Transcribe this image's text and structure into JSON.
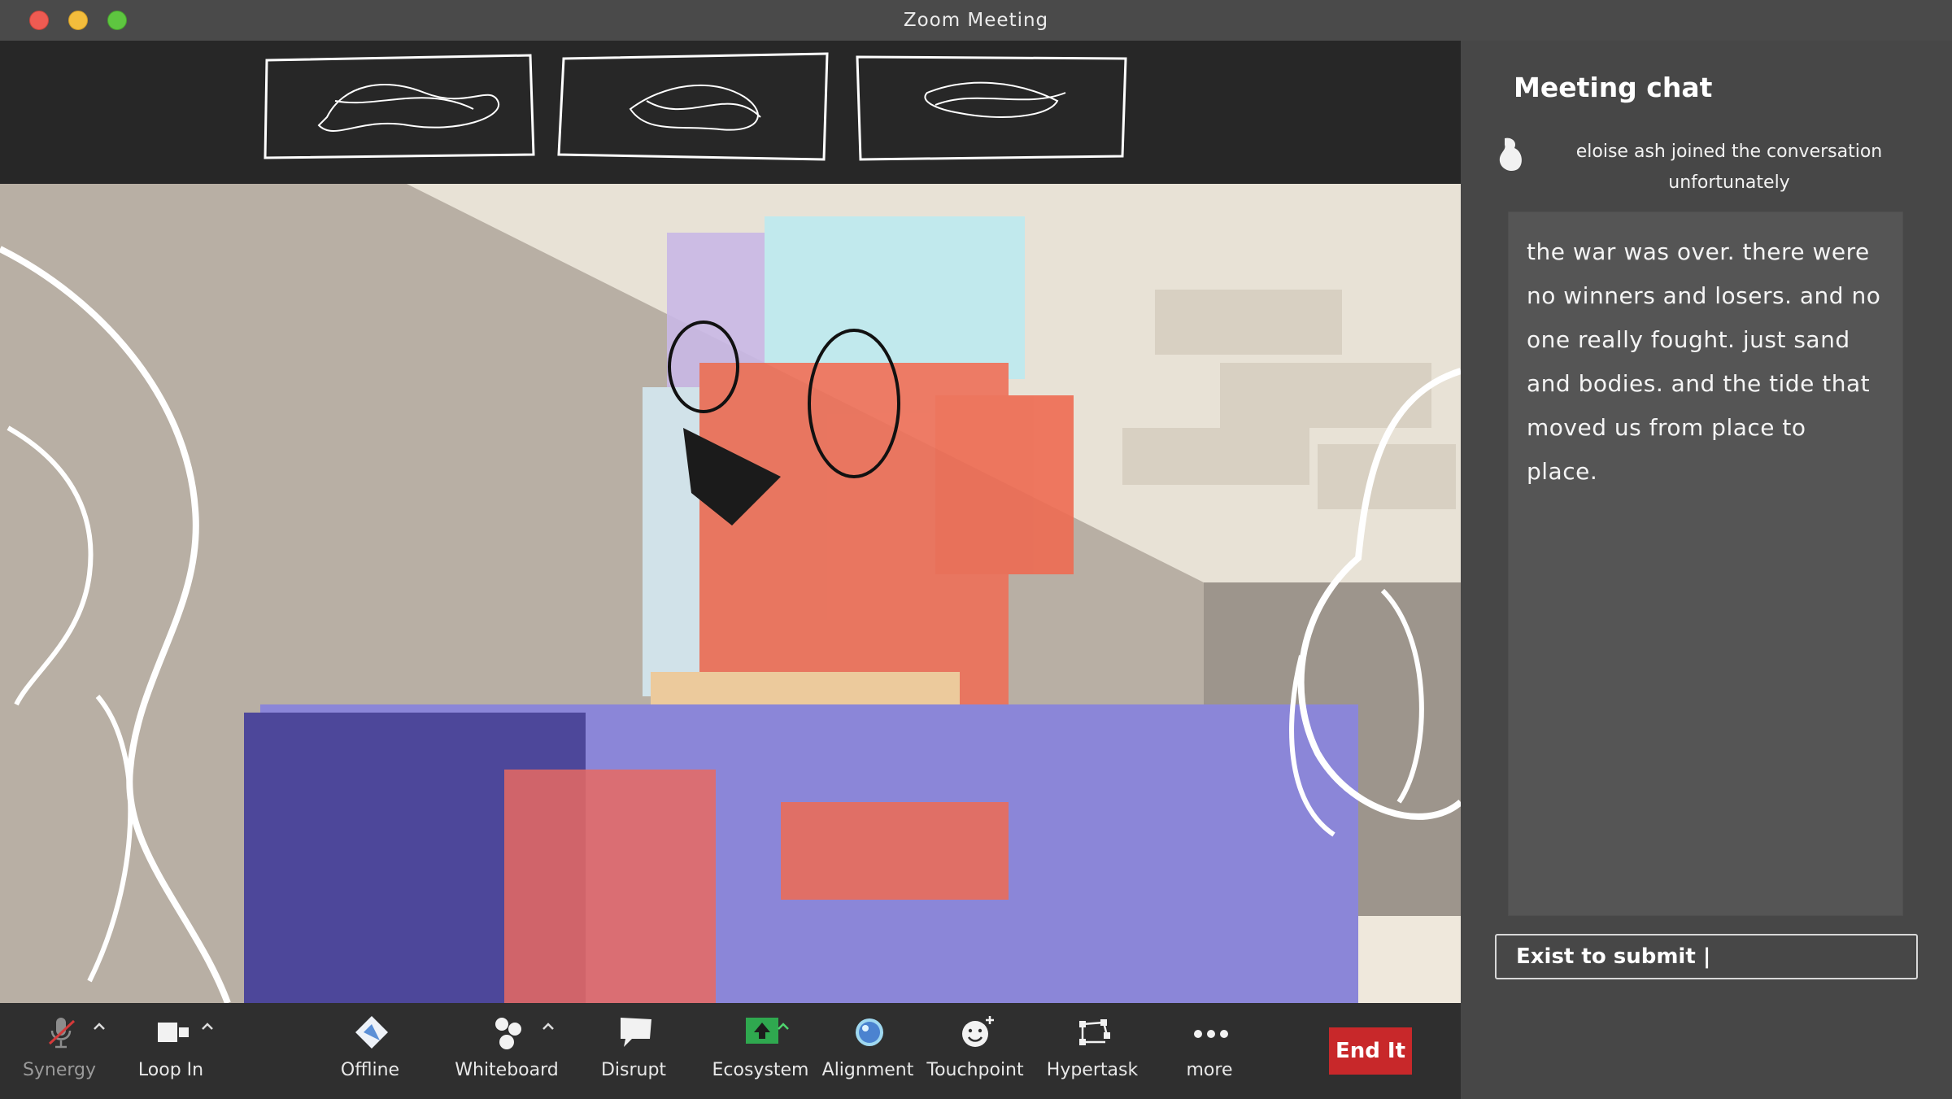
{
  "window": {
    "title": "Zoom Meeting"
  },
  "chat": {
    "title": "Meeting chat",
    "join_notice": "eloise ash  joined the conversation unfortunately",
    "message": "the war was over. there were no winners and losers. and no one really fought. just sand and bodies. and the tide that moved us from place to place.",
    "input_value": "Exist to submit |"
  },
  "toolbar": {
    "items": [
      {
        "label": "Synergy",
        "icon": "muted-mic-icon"
      },
      {
        "label": "Loop In",
        "icon": "video-camera-icon"
      },
      {
        "label": "Offline",
        "icon": "diamond-icon"
      },
      {
        "label": "Whiteboard",
        "icon": "people-icon"
      },
      {
        "label": "Disrupt",
        "icon": "speech-bubble-icon"
      },
      {
        "label": "Ecosystem",
        "icon": "share-screen-icon"
      },
      {
        "label": "Alignment",
        "icon": "bubble-icon"
      },
      {
        "label": "Touchpoint",
        "icon": "smiley-plus-icon"
      },
      {
        "label": "Hypertask",
        "icon": "nodes-icon"
      },
      {
        "label": "more",
        "icon": "more-dots-icon"
      }
    ],
    "end_label": "End It"
  },
  "colors": {
    "accent_green": "#2fa84f",
    "end_red": "#c8282a"
  }
}
